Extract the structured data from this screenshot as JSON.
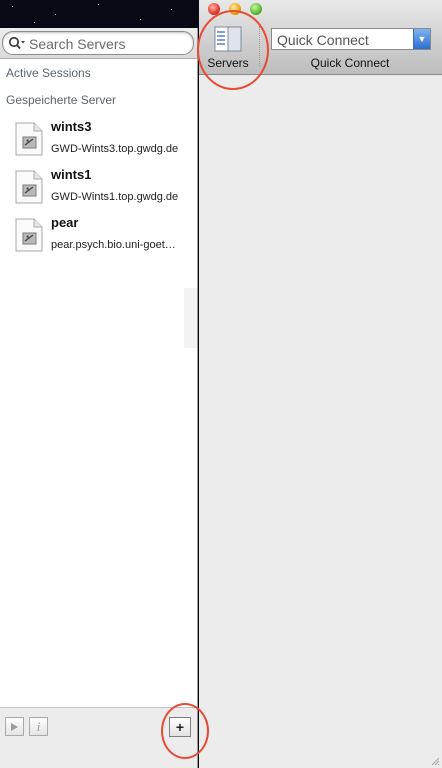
{
  "sidebar": {
    "search": {
      "placeholder": "Search Servers",
      "value": ""
    },
    "sections": {
      "active_sessions": "Active Sessions",
      "saved_servers": "Gespeicherte Server"
    },
    "servers": [
      {
        "name": "wints3",
        "host": "GWD-Wints3.top.gwdg.de"
      },
      {
        "name": "wints1",
        "host": "GWD-Wints1.top.gwdg.de"
      },
      {
        "name": "pear",
        "host": "pear.psych.bio.uni-goet…"
      }
    ],
    "footer": {
      "connect_icon": "play-icon",
      "info_icon": "info-icon",
      "info_label": "i",
      "add_label": "+"
    }
  },
  "toolbar": {
    "servers_label": "Servers",
    "quick_connect_placeholder": "Quick Connect",
    "quick_connect_label": "Quick Connect",
    "quick_connect_value": ""
  },
  "colors": {
    "callout": "#e84b34",
    "combo_arrow": "#2a6fd1",
    "section_text": "#5a6470"
  }
}
